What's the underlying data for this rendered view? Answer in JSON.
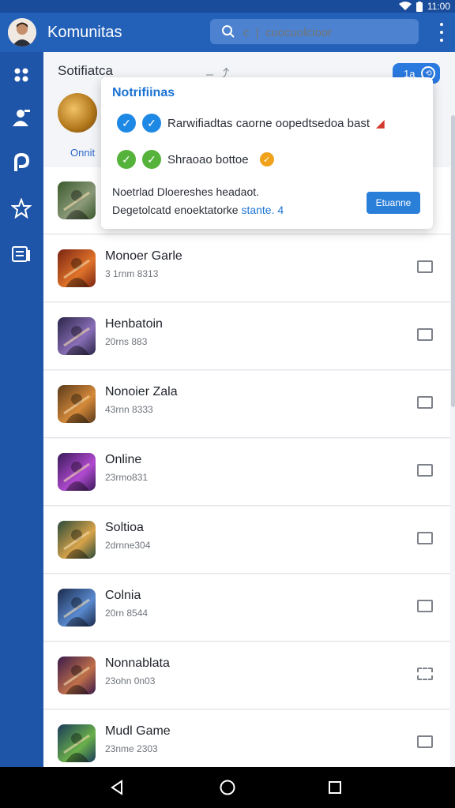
{
  "status_bar": {
    "time": "11:00"
  },
  "app_bar": {
    "title": "Komunitas",
    "search_placeholder": "c  |  cuocuolcioor"
  },
  "section": {
    "title": "Sotifiatca",
    "tools": "–  ⤴",
    "link": "Onnit",
    "pill_label": "1a"
  },
  "popup": {
    "title": "Notrifiinas",
    "row1_text": "Rarwifiadtas caorne oopedtsedoa bast",
    "row2_text": "Shraoao bottoe",
    "message_line1": "Noetrlad Dloereshes headaot.",
    "message_line2": "Degetolcatd enoektatorke",
    "message_link": "stante. 4",
    "button_label": "Etuanne"
  },
  "games": [
    {
      "name": "",
      "meta": "",
      "colors": [
        "#3a5a2c",
        "#8c9a7a"
      ]
    },
    {
      "name": "Monoer Garle",
      "meta": "3 1rnm 8313",
      "colors": [
        "#7a2412",
        "#e0732a"
      ]
    },
    {
      "name": "Henbatoin",
      "meta": "20rns 883",
      "colors": [
        "#2a2548",
        "#8a6fb8"
      ]
    },
    {
      "name": "Nonoier Zala",
      "meta": "43rnn 8333",
      "colors": [
        "#5a3a1a",
        "#d68a3a"
      ]
    },
    {
      "name": "Online",
      "meta": "23rmo831",
      "colors": [
        "#3a1a5a",
        "#b04ad0"
      ]
    },
    {
      "name": "Soltioa",
      "meta": "2drnne304",
      "colors": [
        "#2a4a3a",
        "#d8a44a"
      ]
    },
    {
      "name": "Colnia",
      "meta": "20rn 8544",
      "colors": [
        "#1a2a4a",
        "#5a8ad0"
      ]
    },
    {
      "name": "Nonnablata",
      "meta": "23ohn 0n03",
      "colors": [
        "#3a1a4a",
        "#c0704a"
      ]
    },
    {
      "name": "Mudl Game",
      "meta": "23nme 2303",
      "colors": [
        "#1a3a5a",
        "#6ab04a"
      ]
    }
  ],
  "colors": {
    "primary": "#2360b8",
    "sidebar": "#1f55a8",
    "accent": "#1e88e5",
    "success": "#55b33b",
    "warning": "#f0a21b"
  }
}
